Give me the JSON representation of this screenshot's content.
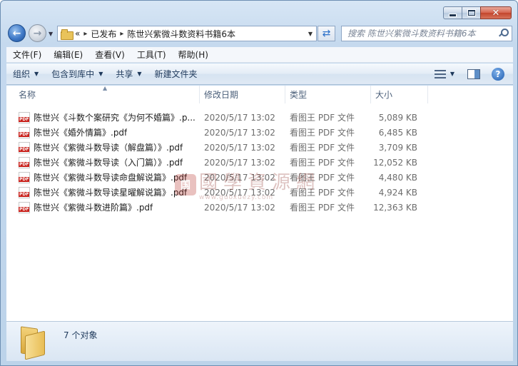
{
  "window": {
    "caption": {
      "close_glyph": "✕"
    }
  },
  "address": {
    "overflow": "«",
    "crumbs": [
      "已发布",
      "陈世兴紫微斗数资料书籍6本"
    ],
    "separator": "▸"
  },
  "search": {
    "placeholder": "搜索 陈世兴紫微斗数资料书籍6本"
  },
  "menu": [
    "文件(F)",
    "编辑(E)",
    "查看(V)",
    "工具(T)",
    "帮助(H)"
  ],
  "toolbar": {
    "organize": "组织",
    "include_library": "包含到库中",
    "share": "共享",
    "new_folder": "新建文件夹"
  },
  "columns": {
    "name": "名称",
    "date": "修改日期",
    "type": "类型",
    "size": "大小"
  },
  "files": [
    {
      "name": "陈世兴《斗数个案研究《为何不婚篇》.p...",
      "date": "2020/5/17 13:02",
      "type": "看图王 PDF 文件",
      "size": "5,089 KB"
    },
    {
      "name": "陈世兴《婚外情篇》.pdf",
      "date": "2020/5/17 13:02",
      "type": "看图王 PDF 文件",
      "size": "6,485 KB"
    },
    {
      "name": "陈世兴《紫微斗数导读（解盘篇）》.pdf",
      "date": "2020/5/17 13:02",
      "type": "看图王 PDF 文件",
      "size": "3,709 KB"
    },
    {
      "name": "陈世兴《紫微斗数导读（入门篇）》.pdf",
      "date": "2020/5/17 13:02",
      "type": "看图王 PDF 文件",
      "size": "12,052 KB"
    },
    {
      "name": "陈世兴《紫微斗数导读命盘解说篇》.pdf",
      "date": "2020/5/17 13:02",
      "type": "看图王 PDF 文件",
      "size": "4,480 KB"
    },
    {
      "name": "陈世兴《紫微斗数导读星曜解说篇》.pdf",
      "date": "2020/5/17 13:02",
      "type": "看图王 PDF 文件",
      "size": "4,924 KB"
    },
    {
      "name": "陈世兴《紫微斗数进阶篇》.pdf",
      "date": "2020/5/17 13:02",
      "type": "看图王 PDF 文件",
      "size": "12,363 KB"
    }
  ],
  "file_icon_label": "PDF",
  "watermark": {
    "logo": "国",
    "text": "國學資源網",
    "url": "www.guoxuezy.com"
  },
  "status": {
    "count": "7 个对象"
  },
  "colors": {
    "accent": "#1e395b",
    "pdf_red": "#c8211b"
  }
}
